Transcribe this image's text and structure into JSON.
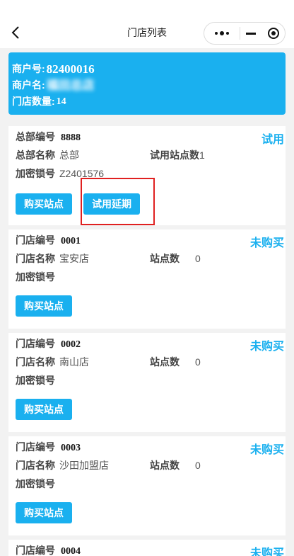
{
  "nav": {
    "title": "门店列表"
  },
  "merchant": {
    "id_label": "商户号:",
    "id_value": "82400016",
    "name_label": "商户名:",
    "name_value": "福田总店",
    "count_label": "门店数量:",
    "count_value": "14"
  },
  "hq": {
    "code_label": "总部编号",
    "code_value": "8888",
    "status": "试用",
    "name_label": "总部名称",
    "name_value": "总部",
    "trial_label": "试用站点数",
    "trial_value": "1",
    "lock_label": "加密锁号",
    "lock_value": "Z2401576",
    "buy_label": "购买站点",
    "extend_label": "试用延期"
  },
  "stores": [
    {
      "code_label": "门店编号",
      "code_value": "0001",
      "status": "未购买",
      "name_label": "门店名称",
      "name_value": "宝安店",
      "sites_label": "站点数",
      "sites_value": "0",
      "lock_label": "加密锁号",
      "buy_label": "购买站点"
    },
    {
      "code_label": "门店编号",
      "code_value": "0002",
      "status": "未购买",
      "name_label": "门店名称",
      "name_value": "南山店",
      "sites_label": "站点数",
      "sites_value": "0",
      "lock_label": "加密锁号",
      "buy_label": "购买站点"
    },
    {
      "code_label": "门店编号",
      "code_value": "0003",
      "status": "未购买",
      "name_label": "门店名称",
      "name_value": "沙田加盟店",
      "sites_label": "站点数",
      "sites_value": "0",
      "lock_label": "加密锁号",
      "buy_label": "购买站点"
    },
    {
      "code_label": "门店编号",
      "code_value": "0004",
      "status": "未购买"
    }
  ],
  "colors": {
    "accent": "#1ab0ef",
    "highlight": "#e02020",
    "background": "#f2f2f2"
  }
}
